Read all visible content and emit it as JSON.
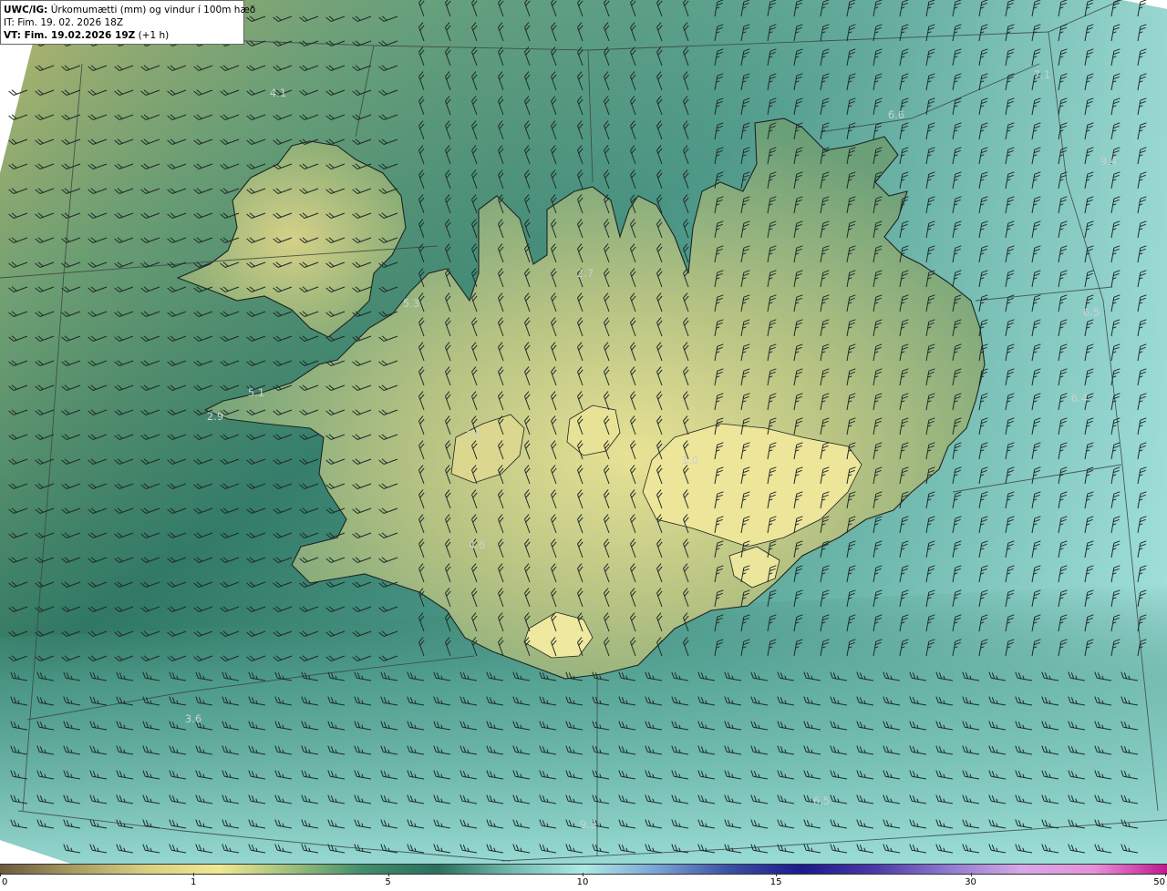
{
  "header": {
    "product": "UWC/IG:",
    "description": " Úrkomumætti (mm) og vindur í 100m hæð",
    "issue_time": "IT: Fim. 19. 02. 2026 18Z",
    "valid_prefix": "VT: ",
    "valid_bold": "Fim. 19.02.2026 19Z",
    "valid_suffix": " (+1 h)"
  },
  "colorbar": {
    "ticks": [
      {
        "value": "0",
        "pos": 0
      },
      {
        "value": "1",
        "pos": 0.166
      },
      {
        "value": "5",
        "pos": 0.333
      },
      {
        "value": "10",
        "pos": 0.5
      },
      {
        "value": "15",
        "pos": 0.666
      },
      {
        "value": "30",
        "pos": 0.833
      },
      {
        "value": "50",
        "pos": 1
      }
    ],
    "colors": [
      "#6b5a3c",
      "#a89a62",
      "#d8d080",
      "#efe893",
      "#9bbf7c",
      "#3f8c6a",
      "#2b6f5e",
      "#6fb9ad",
      "#aee9e6",
      "#7aa4d4",
      "#3b4fa5",
      "#1a1a8c",
      "#4b3aa6",
      "#8f7ad0",
      "#d6a8e6",
      "#e890d8",
      "#c2188f"
    ]
  },
  "map_labels": [
    {
      "text": "4.1"
    },
    {
      "text": "7.1"
    },
    {
      "text": "6.6"
    },
    {
      "text": "9.4"
    },
    {
      "text": "5.3"
    },
    {
      "text": "2.7"
    },
    {
      "text": "6.5"
    },
    {
      "text": "5.1"
    },
    {
      "text": "2.9"
    },
    {
      "text": "6.4"
    },
    {
      "text": "2.6"
    },
    {
      "text": "1.0"
    },
    {
      "text": "4.6"
    },
    {
      "text": "3.6"
    },
    {
      "text": "6.5"
    },
    {
      "text": "9.3"
    }
  ],
  "theme": {
    "sea_dark": "#2a6e5f",
    "sea_light": "#9adfd9",
    "land_high": "#e5df8e",
    "land_mid": "#7fae7c",
    "barb_color": "#1f2a28"
  }
}
